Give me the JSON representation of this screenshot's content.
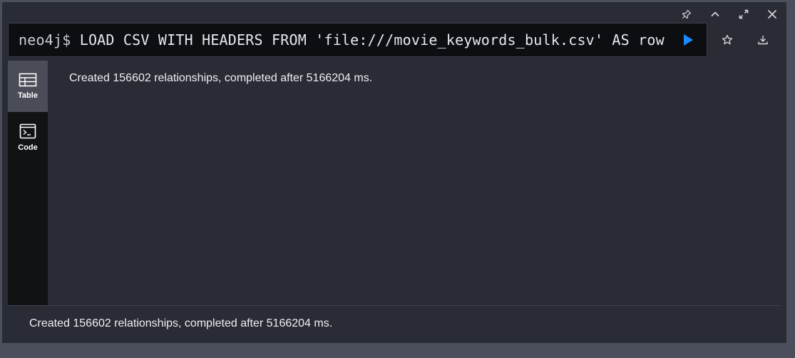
{
  "titlebar": {
    "icons": [
      "pin-icon",
      "collapse-icon",
      "expand-icon",
      "close-icon"
    ]
  },
  "editor": {
    "prompt": "neo4j$",
    "query": "LOAD CSV WITH HEADERS FROM 'file:///movie_keywords_bulk.csv' AS row",
    "run_icon": "play-icon",
    "run_color": "#1a8cff"
  },
  "editor_actions": [
    "star-icon",
    "download-icon"
  ],
  "sidebar": {
    "items": [
      {
        "label": "Table",
        "icon": "table-icon",
        "active": true
      },
      {
        "label": "Code",
        "icon": "terminal-icon",
        "active": false
      }
    ]
  },
  "result": {
    "message": "Created 156602 relationships, completed after 5166204 ms."
  },
  "footer": {
    "message": "Created 156602 relationships, completed after 5166204 ms."
  },
  "colors": {
    "background": "#292c35",
    "editor_bg": "#0d0e11",
    "sidebar_bg": "#111214",
    "sidebar_active": "#4a4d57",
    "accent": "#1a8cff"
  }
}
